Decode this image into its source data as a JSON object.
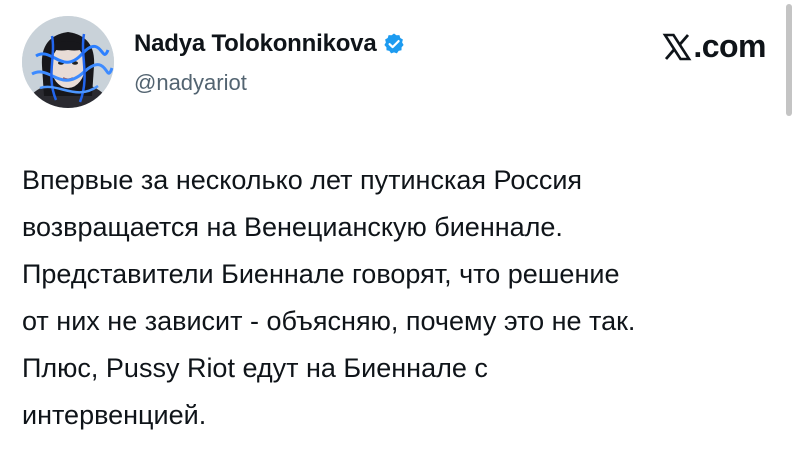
{
  "author": {
    "display_name": "Nadya Tolokonnikova",
    "handle": "@nadyariot",
    "verified": true,
    "avatar_icon": "profile-photo-avatar"
  },
  "brand": {
    "icon": "x-logo-icon",
    "label": ".com"
  },
  "tweet": {
    "lines": [
      "Впервые за несколько лет путинская Россия",
      "возвращается на Венецианскую биеннале.",
      "Представители Биеннале говорят, что решение",
      "от них не зависит - объясняю, почему это не так.",
      "Плюс, Pussy Riot едут на Биеннале с",
      "интервенцией."
    ]
  },
  "colors": {
    "text": "#0f1419",
    "secondary": "#536471",
    "verified": "#1d9bf0",
    "background": "#ffffff"
  }
}
